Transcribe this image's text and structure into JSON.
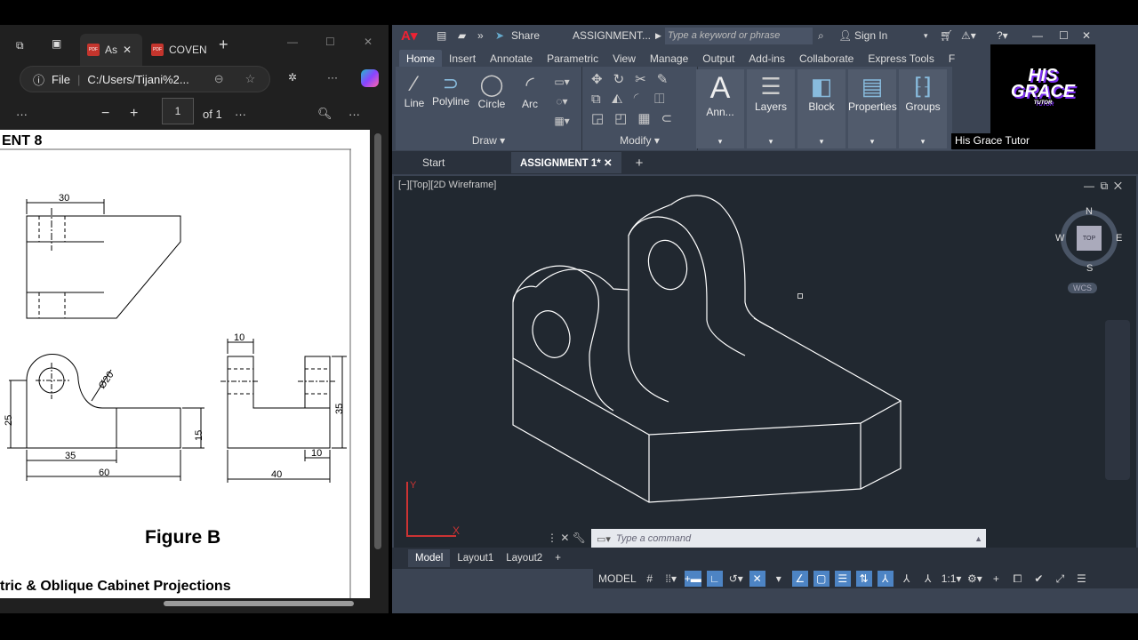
{
  "browser": {
    "tabs": [
      {
        "label": "As"
      },
      {
        "label": "COVEN"
      }
    ],
    "address_prefix": "File",
    "address": "C:/Users/Tijani%2...",
    "page_current": "1",
    "page_total": "of 1"
  },
  "document": {
    "heading": "ENT 8",
    "figure_title": "Figure B",
    "footer_title": "tric & Oblique Cabinet Projections",
    "dims": {
      "top_width": "30",
      "front_height": "25",
      "diameter": "Ø20",
      "front_step": "15",
      "front_len1": "35",
      "front_len2": "60",
      "side_lug": "10",
      "side_height": "35",
      "side_lug2": "10",
      "side_width": "40"
    }
  },
  "autocad": {
    "title": "ASSIGNMENT...",
    "share": "Share",
    "search_placeholder": "Type a keyword or phrase",
    "sign_in": "Sign In",
    "menu_tabs": [
      "Home",
      "Insert",
      "Annotate",
      "Parametric",
      "View",
      "Manage",
      "Output",
      "Add-ins",
      "Collaborate",
      "Express Tools",
      "F"
    ],
    "draw_tools": [
      "Line",
      "Polyline",
      "Circle",
      "Arc"
    ],
    "draw_panel": "Draw",
    "modify_panel": "Modify",
    "big_panels": [
      "Ann...",
      "Layers",
      "Block",
      "Properties",
      "Groups"
    ],
    "doc_tabs": [
      "Start",
      "ASSIGNMENT 1*"
    ],
    "viewport_label": "[−][Top][2D Wireframe]",
    "viewcube": {
      "n": "N",
      "s": "S",
      "e": "E",
      "w": "W",
      "face": "TOP",
      "wcs": "WCS"
    },
    "ucs": {
      "y": "Y",
      "x": "X"
    },
    "command_placeholder": "Type a command",
    "layout_tabs": [
      "Model",
      "Layout1",
      "Layout2"
    ],
    "status": {
      "model": "MODEL",
      "scale": "1:1"
    }
  },
  "overlay": {
    "caption": "His Grace Tutor",
    "logo_line1": "HIS",
    "logo_line2": "GRACE",
    "logo_line3": "TUTOR"
  }
}
